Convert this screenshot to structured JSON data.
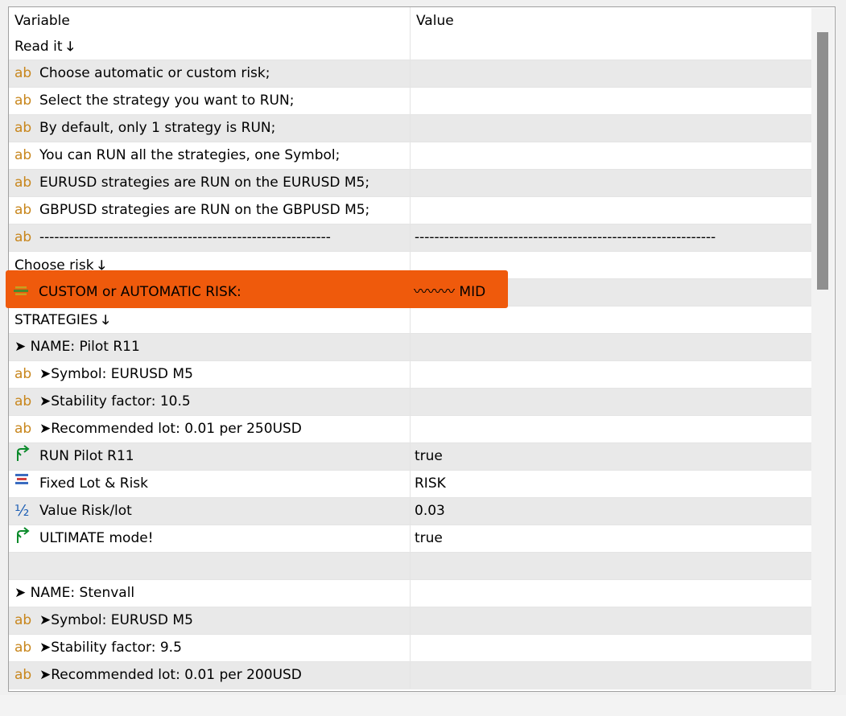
{
  "header": {
    "variable": "Variable",
    "value": "Value"
  },
  "rows": [
    {
      "icon": "",
      "label": "Read it",
      "down": true,
      "value": ""
    },
    {
      "icon": "ab",
      "label": "Choose automatic or custom risk;",
      "value": ""
    },
    {
      "icon": "ab",
      "label": "Select the strategy you want to RUN;",
      "value": ""
    },
    {
      "icon": "ab",
      "label": "By default, only 1 strategy is RUN;",
      "value": ""
    },
    {
      "icon": "ab",
      "label": "You can RUN all the strategies, one Symbol;",
      "value": ""
    },
    {
      "icon": "ab",
      "label": "EURUSD strategies are RUN on the EURUSD M5;",
      "value": ""
    },
    {
      "icon": "ab",
      "label": "GBPUSD strategies are RUN on the GBPUSD M5;",
      "value": ""
    },
    {
      "icon": "ab",
      "label": "-----------------------------------------------------------",
      "value": "-------------------------------------------------------------"
    },
    {
      "icon": "",
      "label": "Choose risk",
      "down": true,
      "value": ""
    },
    {
      "icon": "enum",
      "label": "CUSTOM or AUTOMATIC RISK:",
      "value": "〰〰〰 MID",
      "highlight": true
    },
    {
      "icon": "",
      "label": "STRATEGIES",
      "down": true,
      "value": ""
    },
    {
      "icon": "",
      "label": "➤ NAME: Pilot R11",
      "value": ""
    },
    {
      "icon": "ab",
      "label": "➤Symbol: EURUSD M5",
      "value": ""
    },
    {
      "icon": "ab",
      "label": "➤Stability factor: 10.5",
      "value": ""
    },
    {
      "icon": "ab",
      "label": "➤Recommended lot: 0.01 per 250USD",
      "value": ""
    },
    {
      "icon": "bool",
      "label": "RUN Pilot R11",
      "value": "true"
    },
    {
      "icon": "list",
      "label": "Fixed Lot & Risk",
      "value": "RISK"
    },
    {
      "icon": "half",
      "label": "Value Risk/lot",
      "value": "0.03"
    },
    {
      "icon": "bool",
      "label": "ULTIMATE mode!",
      "value": "true"
    },
    {
      "icon": "",
      "label": "",
      "value": ""
    },
    {
      "icon": "",
      "label": "➤ NAME: Stenvall",
      "value": ""
    },
    {
      "icon": "ab",
      "label": "➤Symbol: EURUSD M5",
      "value": ""
    },
    {
      "icon": "ab",
      "label": "➤Stability factor: 9.5",
      "value": ""
    },
    {
      "icon": "ab",
      "label": "➤Recommended lot: 0.01 per 200USD",
      "value": ""
    }
  ],
  "icons": {
    "ab": "text-param-icon",
    "bool": "bool-param-icon",
    "list": "enum-list-icon",
    "half": "double-param-icon",
    "enum": "enum-param-icon"
  },
  "colors": {
    "highlight": "#ef5a0c",
    "ab_icon": "#c8861c",
    "bool_icon": "#0a8a2a",
    "half_icon": "#1e5fb4"
  }
}
